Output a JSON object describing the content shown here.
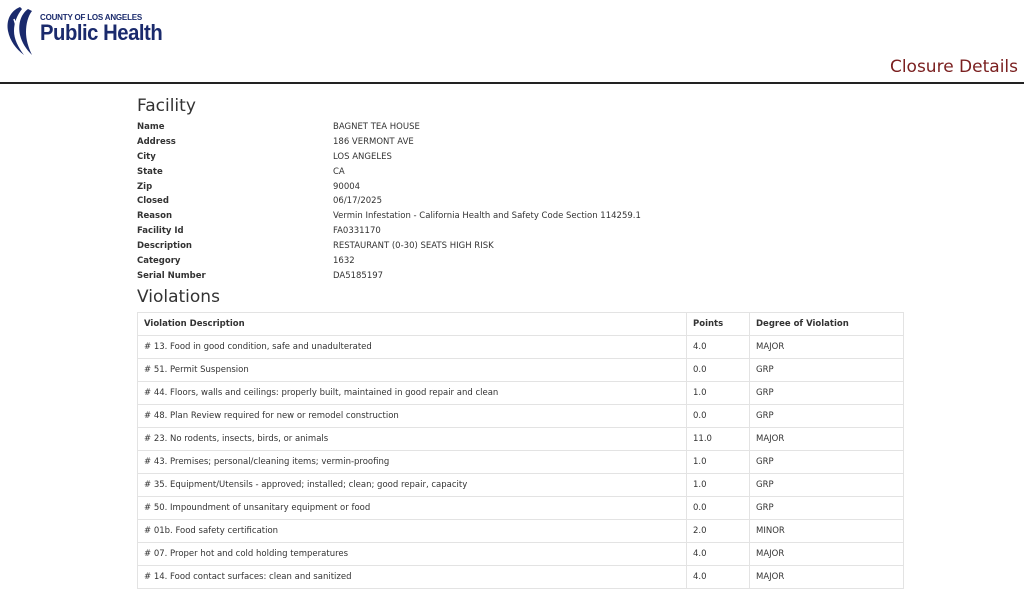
{
  "header": {
    "logo_county": "COUNTY OF LOS ANGELES",
    "logo_title": "Public Health",
    "page_title": "Closure Details"
  },
  "facility": {
    "heading": "Facility",
    "fields": [
      {
        "label": "Name",
        "value": "BAGNET TEA HOUSE"
      },
      {
        "label": "Address",
        "value": "186 VERMONT AVE"
      },
      {
        "label": "City",
        "value": "LOS ANGELES"
      },
      {
        "label": "State",
        "value": "CA"
      },
      {
        "label": "Zip",
        "value": "90004"
      },
      {
        "label": "Closed",
        "value": "06/17/2025"
      },
      {
        "label": "Reason",
        "value": "Vermin Infestation - California Health and Safety Code Section 114259.1"
      },
      {
        "label": "Facility Id",
        "value": "FA0331170"
      },
      {
        "label": "Description",
        "value": "RESTAURANT (0-30) SEATS HIGH RISK"
      },
      {
        "label": "Category",
        "value": "1632"
      },
      {
        "label": "Serial Number",
        "value": "DA5185197"
      }
    ]
  },
  "violations": {
    "heading": "Violations",
    "columns": [
      "Violation Description",
      "Points",
      "Degree of Violation"
    ],
    "rows": [
      [
        "# 13. Food in good condition, safe and unadulterated",
        "4.0",
        "MAJOR"
      ],
      [
        "# 51. Permit Suspension",
        "0.0",
        "GRP"
      ],
      [
        "# 44. Floors, walls and ceilings: properly built, maintained in good repair and clean",
        "1.0",
        "GRP"
      ],
      [
        "# 48. Plan Review required for new or remodel construction",
        "0.0",
        "GRP"
      ],
      [
        "# 23. No rodents, insects, birds, or animals",
        "11.0",
        "MAJOR"
      ],
      [
        "# 43. Premises; personal/cleaning items; vermin-proofing",
        "1.0",
        "GRP"
      ],
      [
        "# 35. Equipment/Utensils - approved; installed; clean; good repair, capacity",
        "1.0",
        "GRP"
      ],
      [
        "# 50. Impoundment of unsanitary equipment or food",
        "0.0",
        "GRP"
      ],
      [
        "# 01b. Food safety certification",
        "2.0",
        "MINOR"
      ],
      [
        "# 07. Proper hot and cold holding temperatures",
        "4.0",
        "MAJOR"
      ],
      [
        "# 14. Food contact surfaces: clean and sanitized",
        "4.0",
        "MAJOR"
      ]
    ]
  },
  "colors": {
    "brand": "#1a2a6c",
    "title": "#7a1f1f"
  }
}
